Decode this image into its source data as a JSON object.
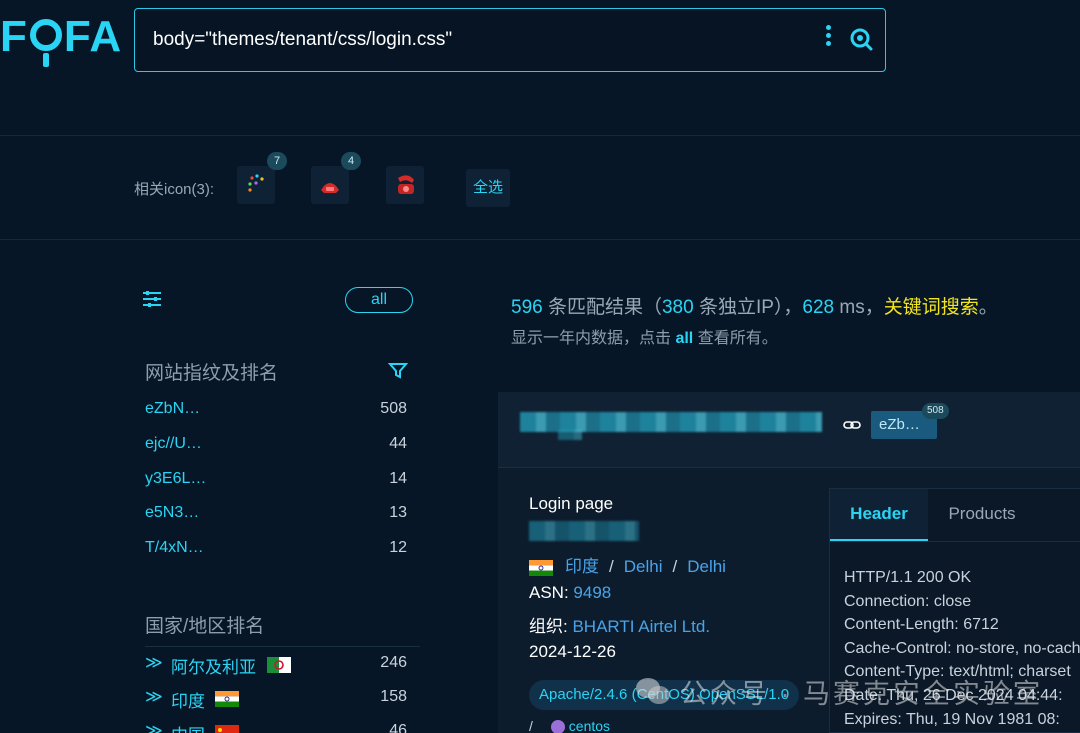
{
  "header": {
    "logo_text": [
      "F",
      "FA"
    ],
    "search_query": "body=\"themes/tenant/css/login.css\""
  },
  "related_icons": {
    "label": "相关icon(3):",
    "items": [
      {
        "name": "colorful-dots",
        "badge": "7"
      },
      {
        "name": "red-phone",
        "badge": "4"
      },
      {
        "name": "red-phone-alt",
        "badge": ""
      }
    ],
    "select_all": "全选"
  },
  "sidebar": {
    "all_label": "all",
    "fingerprint_title": "网站指纹及排名",
    "fingerprints": [
      {
        "key": "eZbN…",
        "count": "508"
      },
      {
        "key": "ejc//U…",
        "count": "44"
      },
      {
        "key": "y3E6L…",
        "count": "14"
      },
      {
        "key": "e5N3…",
        "count": "13"
      },
      {
        "key": "T/4xN…",
        "count": "12"
      }
    ],
    "country_title": "国家/地区排名",
    "countries": [
      {
        "name": "阿尔及利亚",
        "count": "246",
        "flag": "algeria"
      },
      {
        "name": "印度",
        "count": "158",
        "flag": "india"
      },
      {
        "name": "中国",
        "count": "46",
        "flag": "china"
      }
    ]
  },
  "summary": {
    "matches": "596",
    "matches_text": " 条匹配结果（",
    "unique_ip": "380",
    "unique_text": " 条独立IP），",
    "time": "628",
    "time_unit": " ms，",
    "keyword": "关键词搜索",
    "end": "。",
    "hint_pre": "显示一年内数据，点击 ",
    "hint_all": "all",
    "hint_post": " 查看所有。"
  },
  "result": {
    "tag": "eZb…",
    "tag_badge": "508",
    "title": "Login page",
    "country": "印度",
    "region": "Delhi",
    "city": "Delhi",
    "asn_label": "ASN: ",
    "asn": "9498",
    "org_label": "组织: ",
    "org": "BHARTI Airtel Ltd.",
    "date": "2024-12-26",
    "server_chip": "Apache/2.4.6 (CentOS) OpenSSL/1.0",
    "os_prefix": "/",
    "os": "centos"
  },
  "panel": {
    "tabs": [
      "Header",
      "Products"
    ],
    "header_lines": [
      "HTTP/1.1 200 OK",
      "Connection: close",
      "Content-Length: 6712",
      "Cache-Control: no-store, no-cache",
      "Content-Type: text/html; charset",
      "Date: Thu, 26 Dec 2024 04:44:",
      "Expires: Thu, 19 Nov 1981 08:"
    ]
  },
  "watermark": "公众号 · 马赛克安全实验室",
  "colors": {
    "accent": "#2ad4f4",
    "keyword": "#f3e41e",
    "link": "#4aa3e8",
    "bg": "#071626"
  }
}
